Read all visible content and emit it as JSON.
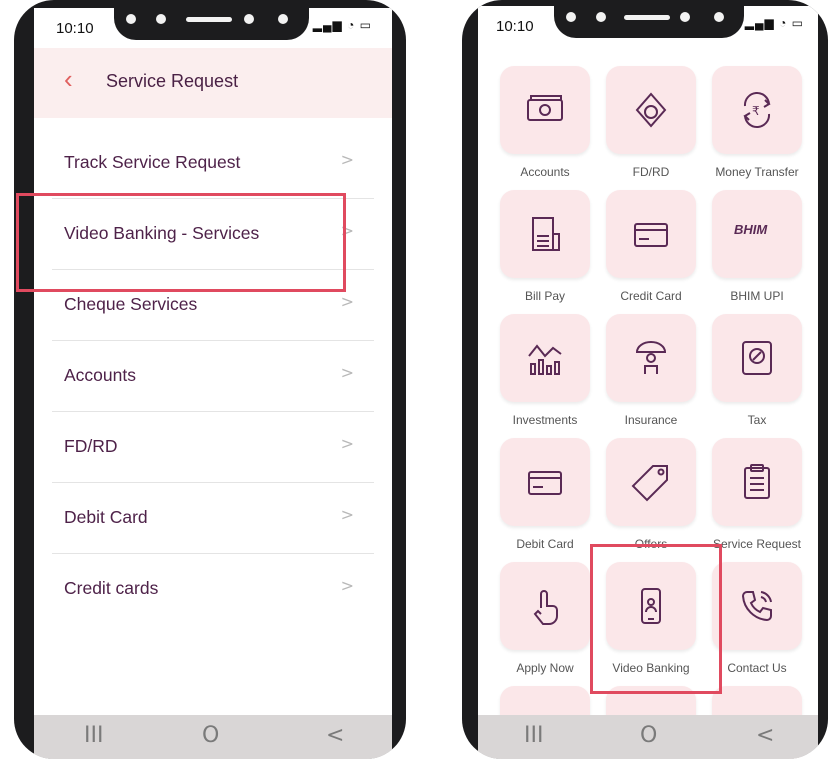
{
  "left_phone": {
    "status_time": "10:10",
    "header_title": "Service Request",
    "items": [
      {
        "label": "Track Service Request"
      },
      {
        "label": "Video Banking - Services"
      },
      {
        "label": "Cheque Services"
      },
      {
        "label": "Accounts"
      },
      {
        "label": "FD/RD"
      },
      {
        "label": "Debit Card"
      },
      {
        "label": "Credit cards"
      }
    ],
    "chevron": ">",
    "nav": {
      "recents": "III",
      "home": "O",
      "back": "<"
    }
  },
  "right_phone": {
    "status_time": "10:10",
    "tiles": [
      {
        "label": "Accounts",
        "icon": "cash-icon"
      },
      {
        "label": "FD/RD",
        "icon": "money-bag-icon"
      },
      {
        "label": "Money Transfer",
        "icon": "rupee-transfer-icon"
      },
      {
        "label": "Bill Pay",
        "icon": "receipt-icon"
      },
      {
        "label": "Credit Card",
        "icon": "credit-card-icon"
      },
      {
        "label": "BHIM UPI",
        "icon": "bhim-logo-icon"
      },
      {
        "label": "Investments",
        "icon": "investment-chart-icon"
      },
      {
        "label": "Insurance",
        "icon": "umbrella-person-icon"
      },
      {
        "label": "Tax",
        "icon": "tax-document-icon"
      },
      {
        "label": "Debit Card",
        "icon": "debit-card-icon"
      },
      {
        "label": "Offers",
        "icon": "offer-tag-icon"
      },
      {
        "label": "Service Request",
        "icon": "clipboard-icon"
      },
      {
        "label": "Apply Now",
        "icon": "tap-hand-icon"
      },
      {
        "label": "Video Banking",
        "icon": "video-phone-icon"
      },
      {
        "label": "Contact Us",
        "icon": "phone-call-icon"
      }
    ],
    "bhim_text": "BHIM",
    "nav": {
      "recents": "III",
      "home": "O",
      "back": "<"
    }
  },
  "colors": {
    "accent": "#e04a5f",
    "text_primary": "#4e2249",
    "tile_bg": "#fbe7e9",
    "icon": "#5a2a55"
  }
}
